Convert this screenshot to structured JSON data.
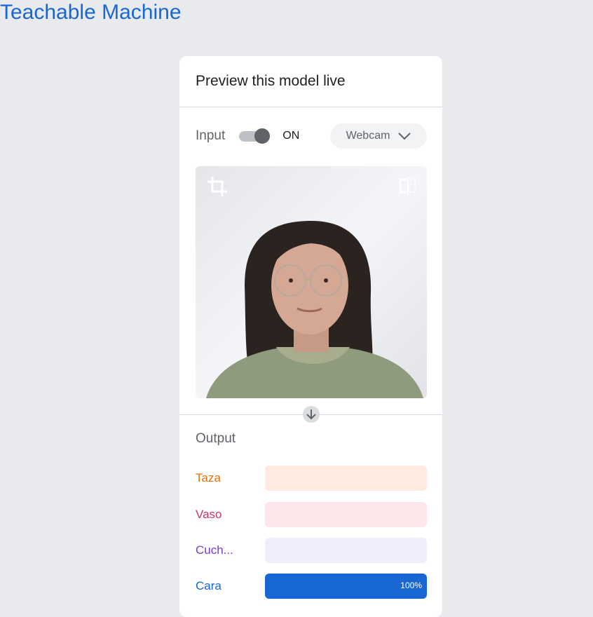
{
  "app": {
    "title": "Teachable Machine"
  },
  "card": {
    "title": "Preview this model live"
  },
  "input": {
    "label": "Input",
    "toggle_state": "ON",
    "source": "Webcam"
  },
  "output": {
    "label": "Output",
    "classes": [
      {
        "name": "Taza",
        "value": 0,
        "percent_label": "",
        "color": "#e8710a",
        "bar_bg": "#feeae1"
      },
      {
        "name": "Vaso",
        "value": 0,
        "percent_label": "",
        "color": "#d01884",
        "bar_bg": "#fde7eb"
      },
      {
        "name": "Cuch...",
        "value": 0,
        "percent_label": "",
        "color": "#7b3ec4",
        "bar_bg": "#f0eefd"
      },
      {
        "name": "Cara",
        "value": 100,
        "percent_label": "100%",
        "color": "#1967d2",
        "bar_bg": "#1967d2"
      }
    ]
  },
  "icons": {
    "crop": "crop-icon",
    "flip": "flip-horizontal-icon",
    "dropdown": "chevron-down-icon",
    "arrow": "arrow-down-icon"
  }
}
